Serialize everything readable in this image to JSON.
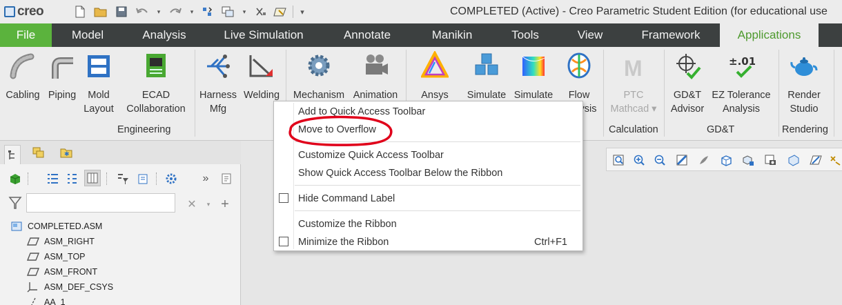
{
  "app": {
    "logo_text": "creo",
    "window_title": "COMPLETED (Active) - Creo Parametric Student Edition (for educational use"
  },
  "ribbon_tabs": [
    "File",
    "Model",
    "Analysis",
    "Live Simulation",
    "Annotate",
    "Manikin",
    "Tools",
    "View",
    "Framework",
    "Applications"
  ],
  "active_tab": "Applications",
  "ribbon_buttons": {
    "cabling": "Cabling",
    "piping": "Piping",
    "mold_line1": "Mold",
    "mold_line2": "Layout",
    "ecad_line1": "ECAD",
    "ecad_line2": "Collaboration",
    "harness_line1": "Harness",
    "harness_line2": "Mfg",
    "welding": "Welding",
    "mechanism": "Mechanism",
    "animation": "Animation",
    "ansys": "Ansys",
    "simulate1": "Simulate",
    "simulate2": "Simulate",
    "flow_line1": "Flow",
    "flow_line2_partial": "ysis",
    "ptc_line1": "PTC",
    "ptc_line2": "Mathcad",
    "gdt_line1": "GD&T",
    "gdt_line2": "Advisor",
    "ez_line1": "EZ Tolerance",
    "ez_line2": "Analysis",
    "render_line1": "Render",
    "render_line2": "Studio"
  },
  "ribbon_groups": {
    "engineering": "Engineering",
    "calculation": "Calculation",
    "gdt": "GD&T",
    "rendering": "Rendering"
  },
  "context_menu": {
    "items": {
      "add_qat": "Add to Quick Access Toolbar",
      "move_overflow": "Move to Overflow",
      "customize_qat": "Customize Quick Access Toolbar",
      "show_qat_below": "Show Quick Access Toolbar Below the Ribbon",
      "hide_label": "Hide Command Label",
      "customize_ribbon": "Customize the Ribbon",
      "minimize_ribbon": "Minimize the Ribbon"
    },
    "minimize_shortcut": "Ctrl+F1",
    "hide_label_checked": false,
    "minimize_checked": false,
    "highlight_color": "#e0001a"
  },
  "model_tree": {
    "filter_placeholder": "",
    "nodes": [
      "COMPLETED.ASM",
      "ASM_RIGHT",
      "ASM_TOP",
      "ASM_FRONT",
      "ASM_DEF_CSYS",
      "AA_1"
    ]
  },
  "colors": {
    "file_tab": "#5bb33d",
    "tab_bar": "#3c4040",
    "active_tab_text": "#4e9a2e"
  }
}
